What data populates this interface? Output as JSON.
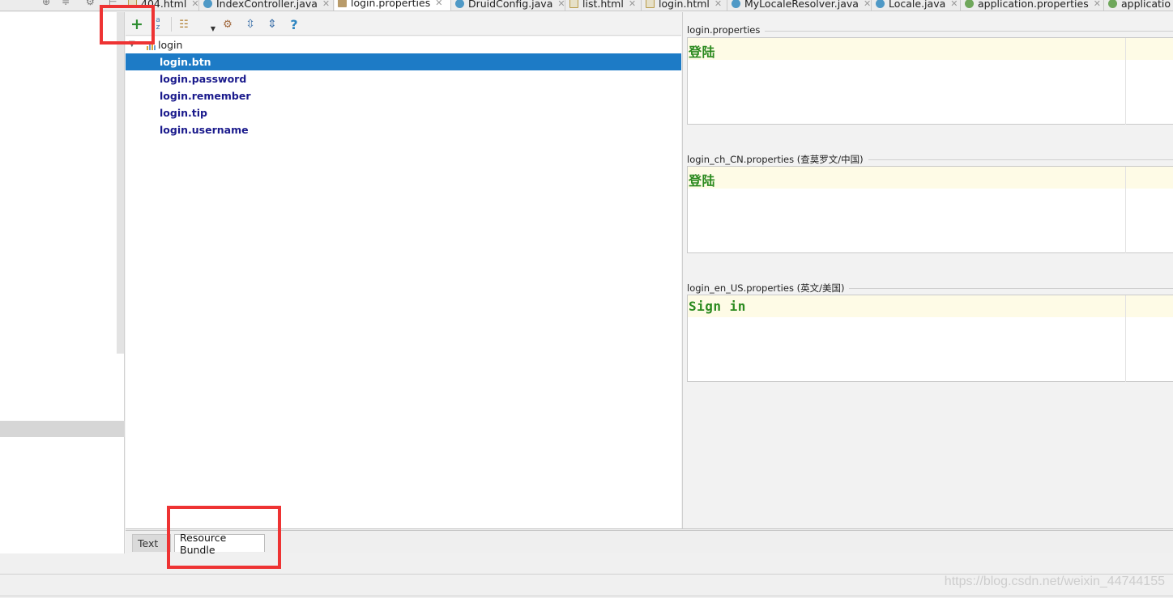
{
  "tabs": [
    {
      "label": "404.html",
      "icon": "html-file-icon",
      "active": false
    },
    {
      "label": "IndexController.java",
      "icon": "java-class-icon",
      "active": false
    },
    {
      "label": "login.properties",
      "icon": "properties-file-icon",
      "active": true
    },
    {
      "label": "DruidConfig.java",
      "icon": "java-class-icon",
      "active": false
    },
    {
      "label": "list.html",
      "icon": "html-file-icon",
      "active": false
    },
    {
      "label": "login.html",
      "icon": "html-file-icon",
      "active": false
    },
    {
      "label": "MyLocaleResolver.java",
      "icon": "java-class-icon",
      "active": false
    },
    {
      "label": "Locale.java",
      "icon": "java-class-icon",
      "active": false
    },
    {
      "label": "application.properties",
      "icon": "spring-properties-icon",
      "active": false
    },
    {
      "label": "applicatio",
      "icon": "spring-properties-icon",
      "active": false
    }
  ],
  "toolbar": {
    "add": "+",
    "sort_top": "a",
    "sort_bottom": "z",
    "help": "?"
  },
  "tree": {
    "root": "login",
    "keys": [
      "login.btn",
      "login.password",
      "login.remember",
      "login.tip",
      "login.username"
    ],
    "selected": "login.btn"
  },
  "values": [
    {
      "file": "login.properties",
      "value": "登陆"
    },
    {
      "file": "login_ch_CN.properties (查莫罗文/中国)",
      "value": "登陆"
    },
    {
      "file": "login_en_US.properties (英文/美国)",
      "value": "Sign in"
    }
  ],
  "editor_tabs": {
    "text": "Text",
    "resource_bundle": "Resource Bundle",
    "active": "Resource Bundle"
  },
  "watermark": "https://blog.csdn.net/weixin_44744155",
  "colors": {
    "selection": "#1d7bc6",
    "key_text": "#1a1a8c",
    "value_text": "#2b8a1f",
    "value_line_bg": "#fefbe6",
    "highlight": "#ee3333"
  }
}
